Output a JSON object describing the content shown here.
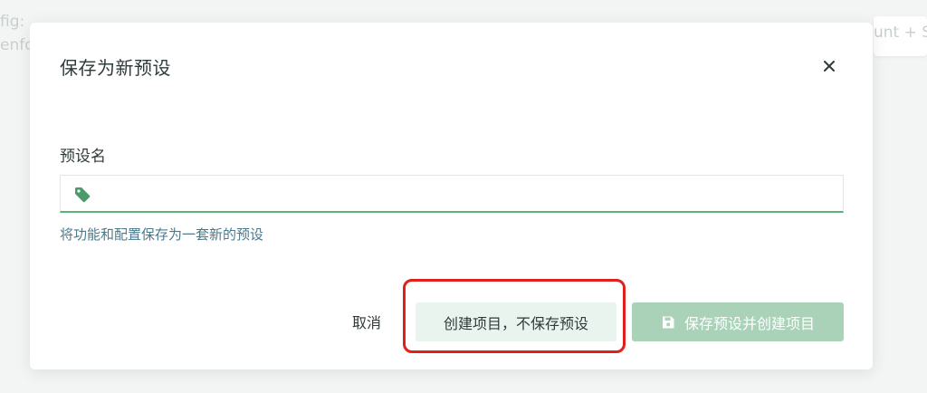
{
  "background": {
    "fragment_top_left_1": "fig:",
    "fragment_top_left_2": "enfo",
    "fragment_top_right": "unt + S"
  },
  "dialog": {
    "title": "保存为新预设",
    "close_icon": "close-icon",
    "field_label": "预设名",
    "input": {
      "value": "",
      "placeholder": "",
      "icon": "tag-icon"
    },
    "helper_text": "将功能和配置保存为一套新的预设",
    "buttons": {
      "cancel_label": "取消",
      "create_label": "创建项目，不保存预设",
      "save_label": "保存预设并创建项目",
      "save_icon": "save-icon"
    }
  },
  "colors": {
    "accent_green": "#5bb37c",
    "save_button_disabled": "#a9d2b9",
    "create_button_bg": "#e9f4ef",
    "helper_text": "#4a7a8c",
    "highlight_red": "#e0201c"
  }
}
